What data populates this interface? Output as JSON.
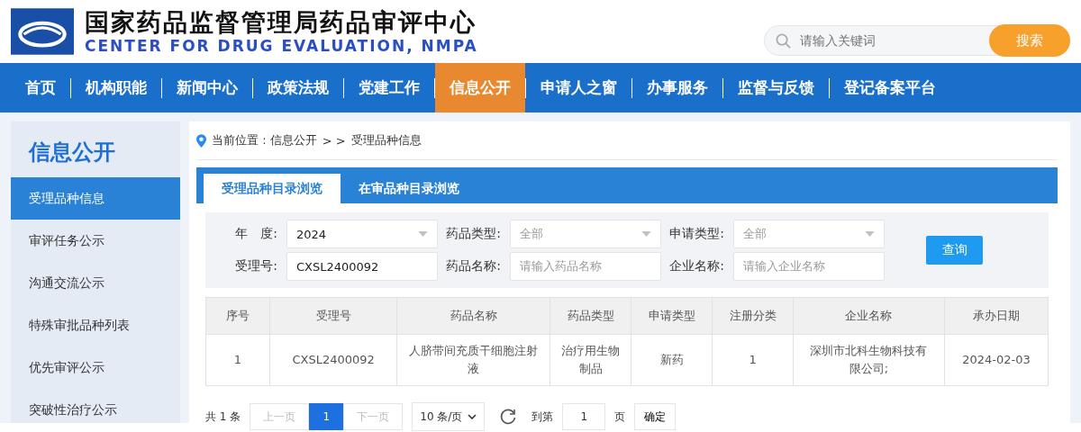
{
  "header": {
    "title": "国家药品监督管理局药品审评中心",
    "subtitle": "CENTER FOR DRUG EVALUATION, NMPA",
    "search": {
      "placeholder": "请输入关键词",
      "button": "搜索"
    }
  },
  "nav": [
    {
      "label": "首页",
      "selected": false
    },
    {
      "label": "机构职能",
      "selected": false
    },
    {
      "label": "新闻中心",
      "selected": false
    },
    {
      "label": "政策法规",
      "selected": false
    },
    {
      "label": "党建工作",
      "selected": false
    },
    {
      "label": "信息公开",
      "selected": true
    },
    {
      "label": "申请人之窗",
      "selected": false
    },
    {
      "label": "办事服务",
      "selected": false
    },
    {
      "label": "监督与反馈",
      "selected": false
    },
    {
      "label": "登记备案平台",
      "selected": false
    }
  ],
  "sidebar": {
    "title": "信息公开",
    "items": [
      {
        "label": "受理品种信息",
        "selected": true
      },
      {
        "label": "审评任务公示",
        "selected": false
      },
      {
        "label": "沟通交流公示",
        "selected": false
      },
      {
        "label": "特殊审批品种列表",
        "selected": false
      },
      {
        "label": "优先审评公示",
        "selected": false
      },
      {
        "label": "突破性治疗公示",
        "selected": false
      }
    ]
  },
  "breadcrumb": {
    "prefix": "当前位置 : 信息公开",
    "separator": "> >",
    "current": "受理品种信息"
  },
  "tabs": [
    {
      "label": "受理品种目录浏览",
      "selected": true
    },
    {
      "label": "在审品种目录浏览",
      "selected": false
    }
  ],
  "filters": [
    {
      "kind": "select",
      "label": "年　度:",
      "value": "2024"
    },
    {
      "kind": "select",
      "label": "药品类型:",
      "placeholder": "全部"
    },
    {
      "kind": "select",
      "label": "申请类型:",
      "placeholder": "全部"
    },
    {
      "kind": "input",
      "label": "受理号:",
      "value": "CXSL2400092"
    },
    {
      "kind": "input",
      "label": "药品名称:",
      "placeholder": "请输入药品名称"
    },
    {
      "kind": "input",
      "label": "企业名称:",
      "placeholder": "请输入企业名称"
    }
  ],
  "query_button": "查询",
  "table": {
    "columns": [
      "序号",
      "受理号",
      "药品名称",
      "药品类型",
      "申请类型",
      "注册分类",
      "企业名称",
      "承办日期"
    ],
    "rows": [
      [
        "1",
        "CXSL2400092",
        "人脐带间充质干细胞注射液",
        "治疗用生物制品",
        "新药",
        "1",
        "深圳市北科生物科技有限公司;",
        "2024-02-03"
      ]
    ]
  },
  "pagination": {
    "total": "共 1 条",
    "prev": "上一页",
    "pages": [
      {
        "label": "1",
        "selected": true
      }
    ],
    "next": "下一页",
    "page_size": "10 条/页",
    "goto_label": "到第",
    "goto_value": "1",
    "page_unit": "页",
    "confirm": "确定"
  }
}
